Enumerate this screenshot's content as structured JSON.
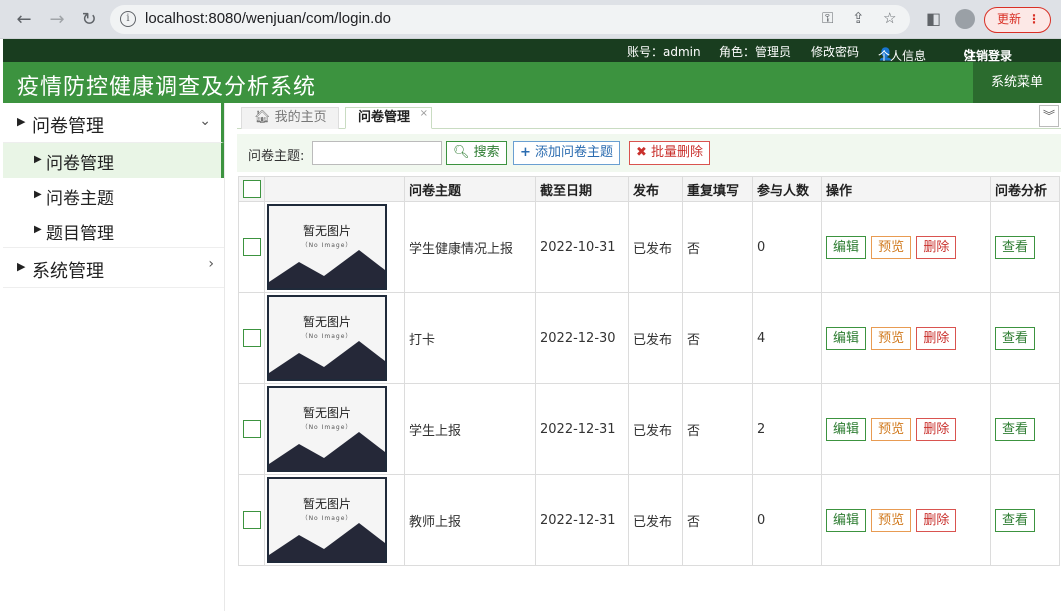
{
  "browser": {
    "url": "localhost:8080/wenjuan/com/login.do",
    "update_label": "更新"
  },
  "topbar": {
    "account": "账号：admin",
    "role": "角色：管理员",
    "change_password": "修改密码",
    "profile": "个人信息",
    "logout": "注销登录"
  },
  "header": {
    "title": "疫情防控健康调查及分析系统",
    "system_menu": "系统菜单"
  },
  "sidebar": {
    "group1": "问卷管理",
    "sub1": "问卷管理",
    "sub2": "问卷主题",
    "sub3": "题目管理",
    "group2": "系统管理"
  },
  "tabs": {
    "home": "我的主页",
    "active": "问卷管理",
    "close": "×"
  },
  "toolbar": {
    "topic_label": "问卷主题:",
    "search_value": "",
    "search": "搜索",
    "add": "添加问卷主题",
    "batch_delete": "批量删除"
  },
  "table": {
    "headers": {
      "topic": "问卷主题",
      "deadline": "截至日期",
      "publish": "发布",
      "repeat": "重复填写",
      "participants": "参与人数",
      "actions": "操作",
      "analysis": "问卷分析"
    },
    "image_placeholder": {
      "main": "暂无图片",
      "sub": "（No Image）"
    },
    "action_labels": {
      "edit": "编辑",
      "preview": "预览",
      "delete": "删除",
      "view": "查看"
    },
    "rows": [
      {
        "topic": "学生健康情况上报",
        "deadline": "2022-10-31",
        "publish": "已发布",
        "repeat": "否",
        "participants": "0"
      },
      {
        "topic": "打卡",
        "deadline": "2022-12-30",
        "publish": "已发布",
        "repeat": "否",
        "participants": "4"
      },
      {
        "topic": "学生上报",
        "deadline": "2022-12-31",
        "publish": "已发布",
        "repeat": "否",
        "participants": "2"
      },
      {
        "topic": "教师上报",
        "deadline": "2022-12-31",
        "publish": "已发布",
        "repeat": "否",
        "participants": "0"
      }
    ]
  },
  "colors": {
    "brand_green": "#3c933f",
    "dark_green": "#193d1f",
    "danger": "#d9534f",
    "warning": "#e89b52"
  }
}
